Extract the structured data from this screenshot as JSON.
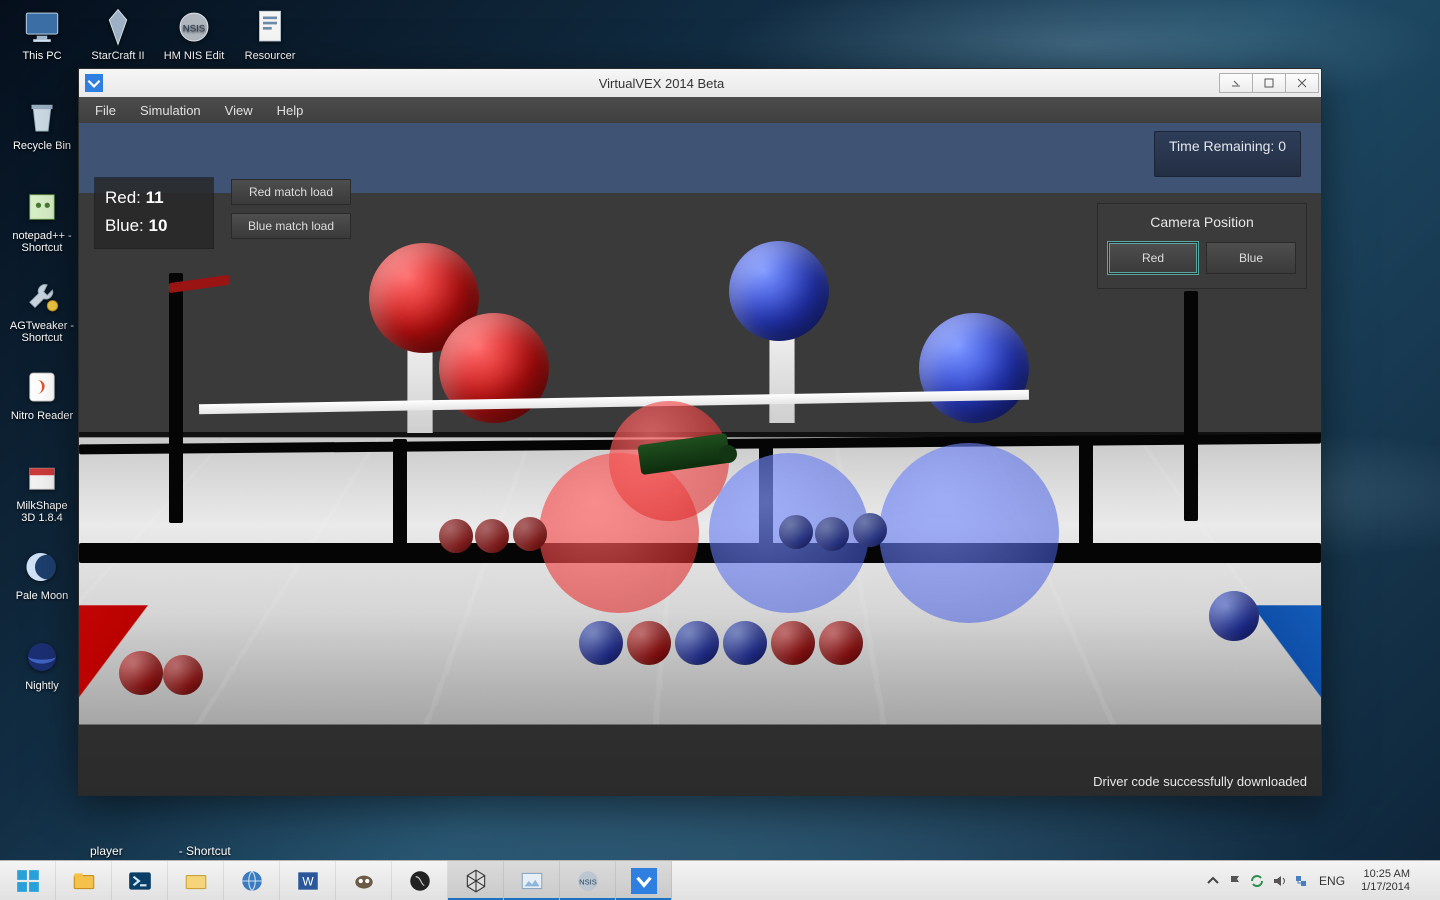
{
  "desktop": {
    "icons": [
      "This PC",
      "StarCraft II",
      "HM NIS Edit",
      "Resourcer",
      "Recycle Bin",
      "notepad++ - Shortcut",
      "AGTweaker - Shortcut",
      "Nitro Reader",
      "MilkShape 3D 1.8.4",
      "Pale Moon",
      "Nightly"
    ],
    "obscured": [
      "player",
      "- Shortcut"
    ]
  },
  "window": {
    "title": "VirtualVEX 2014 Beta",
    "menu": {
      "file": "File",
      "simulation": "Simulation",
      "view": "View",
      "help": "Help"
    }
  },
  "hud": {
    "score_red_label": "Red:",
    "score_red_value": "11",
    "score_blue_label": "Blue:",
    "score_blue_value": "10",
    "red_load": "Red match load",
    "blue_load": "Blue match load",
    "timer_label": "Time Remaining:",
    "timer_value": "0",
    "camera_heading": "Camera Position",
    "camera_red": "Red",
    "camera_blue": "Blue",
    "status": "Driver code successfully downloaded"
  },
  "taskbar": {
    "lang": "ENG",
    "time": "10:25 AM",
    "date": "1/17/2014"
  }
}
